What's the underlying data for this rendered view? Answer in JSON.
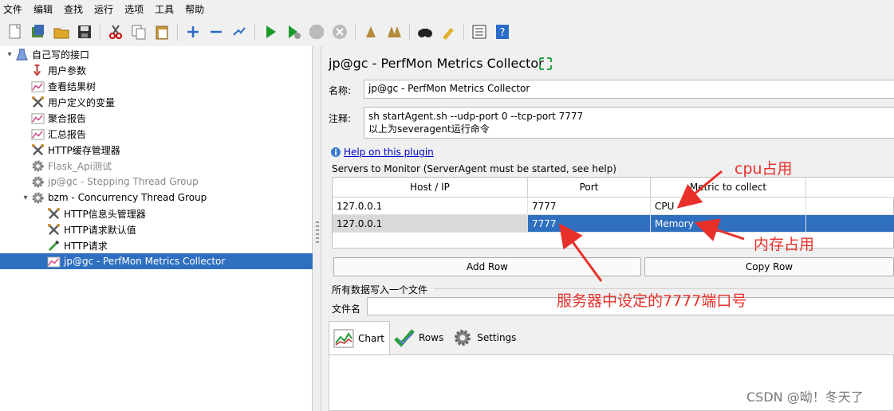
{
  "menu": [
    "文件",
    "编辑",
    "查找",
    "运行",
    "选项",
    "工具",
    "帮助"
  ],
  "toolbar_icons": [
    "new-icon",
    "templates-icon",
    "open-icon",
    "save-icon",
    "cut-icon",
    "copy-icon",
    "paste-icon",
    "expand-icon",
    "collapse-icon",
    "toggle-icon",
    "start-icon",
    "start-no-pause-icon",
    "stop-icon",
    "shutdown-icon",
    "clear-icon",
    "clear-all-icon",
    "search-icon",
    "reset-search-icon",
    "function-helper-icon",
    "help-icon"
  ],
  "tree": [
    {
      "label": "自己写的接口",
      "icon": "test-plan-icon",
      "depth": 0,
      "toggle": "▾",
      "state": ""
    },
    {
      "label": "用户参数",
      "icon": "user-params-icon",
      "depth": 1,
      "toggle": "",
      "state": ""
    },
    {
      "label": "查看结果树",
      "icon": "listener-icon",
      "depth": 1,
      "toggle": "",
      "state": ""
    },
    {
      "label": "用户定义的变量",
      "icon": "config-wrench-icon",
      "depth": 1,
      "toggle": "",
      "state": ""
    },
    {
      "label": "聚合报告",
      "icon": "listener-icon",
      "depth": 1,
      "toggle": "",
      "state": ""
    },
    {
      "label": "汇总报告",
      "icon": "listener-icon",
      "depth": 1,
      "toggle": "",
      "state": ""
    },
    {
      "label": "HTTP缓存管理器",
      "icon": "config-wrench-icon",
      "depth": 1,
      "toggle": "",
      "state": ""
    },
    {
      "label": "Flask_Api测试",
      "icon": "thread-group-gear-icon",
      "depth": 1,
      "toggle": "",
      "state": "disabled"
    },
    {
      "label": "jp@gc - Stepping Thread Group",
      "icon": "thread-group-gear-icon",
      "depth": 1,
      "toggle": "",
      "state": "disabled"
    },
    {
      "label": "bzm - Concurrency Thread Group",
      "icon": "thread-group-gear-icon",
      "depth": 1,
      "toggle": "▾",
      "state": ""
    },
    {
      "label": "HTTP信息头管理器",
      "icon": "config-wrench-icon",
      "depth": 2,
      "toggle": "",
      "state": ""
    },
    {
      "label": "HTTP请求默认值",
      "icon": "config-wrench-icon",
      "depth": 2,
      "toggle": "",
      "state": ""
    },
    {
      "label": "HTTP请求",
      "icon": "sampler-pipette-icon",
      "depth": 2,
      "toggle": "",
      "state": ""
    },
    {
      "label": "jp@gc - PerfMon Metrics Collector",
      "icon": "listener-icon",
      "depth": 2,
      "toggle": "",
      "state": "selected"
    }
  ],
  "panel": {
    "title": "jp@gc - PerfMon Metrics Collector",
    "name_label": "名称:",
    "name_value": "jp@gc - PerfMon Metrics Collector",
    "comment_label": "注释:",
    "comment_line1": "sh startAgent.sh --udp-port 0 --tcp-port 7777",
    "comment_line2": "以上为severagent运行命令",
    "help_link": "Help on this plugin",
    "servers_title": "Servers to Monitor (ServerAgent must be started, see help)",
    "columns": [
      "Host / IP",
      "Port",
      "Metric to collect"
    ],
    "rows": [
      {
        "host": "127.0.0.1",
        "port": "7777",
        "metric": "CPU",
        "selected": false
      },
      {
        "host": "127.0.0.1",
        "port": "7777",
        "metric": "Memory",
        "selected": true
      }
    ],
    "add_row": "Add Row",
    "copy_row": "Copy Row",
    "file_section": "所有数据写入一个文件",
    "file_label": "文件名",
    "file_value": "",
    "tabs": [
      {
        "label": "Chart",
        "icon": "chart-icon",
        "active": true
      },
      {
        "label": "Rows",
        "icon": "rows-check-icon",
        "active": false
      },
      {
        "label": "Settings",
        "icon": "settings-gear-icon",
        "active": false
      }
    ]
  },
  "annotations": {
    "cpu": "cpu占用",
    "memory": "内存占用",
    "port": "服务器中设定的7777端口号"
  },
  "watermark": "CSDN @呦！冬天了",
  "colors": {
    "selection": "#2f6fc0",
    "annotation": "#e8302a",
    "link": "#0000cc"
  }
}
